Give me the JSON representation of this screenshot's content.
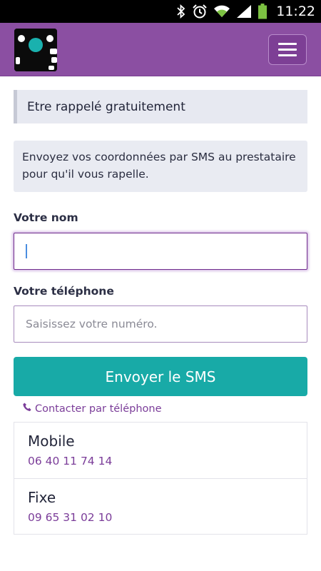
{
  "status_bar": {
    "time": "11:22",
    "icons": [
      "bluetooth-icon",
      "alarm-clock-icon",
      "wifi-icon",
      "signal-icon",
      "battery-icon"
    ]
  },
  "navbar": {
    "logo_icon": "app-logo-icon",
    "menu_icon": "hamburger-menu-icon",
    "background": "#8b4fa2"
  },
  "banner": {
    "title": "Etre rappelé gratuitement"
  },
  "info": {
    "text": "Envoyez vos coordonnées par SMS au prestataire pour qu'il vous rapelle."
  },
  "form": {
    "name_label": "Votre nom",
    "name_value": "",
    "phone_label": "Votre téléphone",
    "phone_placeholder": "Saisissez votre numéro.",
    "submit_label": "Envoyer le SMS",
    "submit_color": "#18aaa7"
  },
  "contact": {
    "link_label": "Contacter par téléphone",
    "link_icon": "phone-icon",
    "accent_color": "#7b3d99",
    "items": [
      {
        "title": "Mobile",
        "number": "06 40 11 74 14"
      },
      {
        "title": "Fixe",
        "number": "09 65 31 02 10"
      }
    ]
  }
}
